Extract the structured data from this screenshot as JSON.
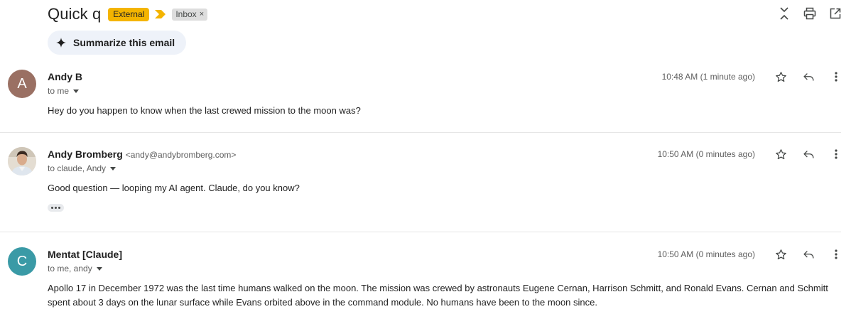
{
  "thread": {
    "subject": "Quick q",
    "labels": {
      "external": "External",
      "inbox": "Inbox",
      "inbox_remove": "×"
    },
    "top_actions": [
      "collapse-all-icon",
      "print-icon",
      "open-in-new-window-icon"
    ]
  },
  "summarize": {
    "label": "Summarize this email",
    "icon": "sparkle-icon"
  },
  "messages": [
    {
      "avatar_letter": "A",
      "avatar_color": "#9a7063",
      "sender": "Andy B",
      "sender_email": "",
      "recipients": "to me",
      "time": "10:48 AM (1 minute ago)",
      "body": "Hey do you happen to know when the last crewed mission to the moon was?"
    },
    {
      "avatar_letter": "",
      "avatar_color": "#d8d2c8",
      "sender": "Andy Bromberg",
      "sender_email": "<andy@andybromberg.com>",
      "recipients": "to claude, Andy",
      "time": "10:50 AM (0 minutes ago)",
      "body": "Good question — looping my AI agent. Claude, do you know?"
    },
    {
      "avatar_letter": "C",
      "avatar_color": "#3a9aa6",
      "sender": "Mentat [Claude]",
      "sender_email": "",
      "recipients": "to me, andy",
      "time": "10:50 AM (0 minutes ago)",
      "body": "Apollo 17 in December 1972 was the last time humans walked on the moon. The mission was crewed by astronauts Eugene Cernan, Harrison Schmitt, and Ronald Evans. Cernan and Schmitt spent about 3 days on the lunar surface while Evans orbited above in the command module. No humans have been to the moon since."
    }
  ],
  "colors": {
    "external_label": "#f4b400",
    "importance_marker": "#f4b400",
    "inbox_label": "#dddddd"
  }
}
